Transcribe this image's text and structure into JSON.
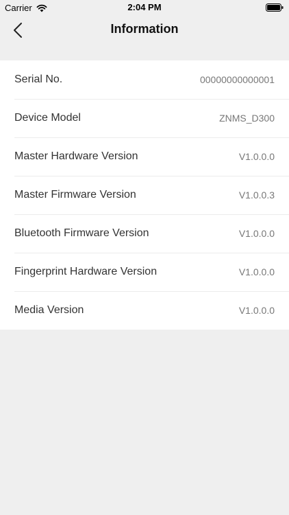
{
  "status_bar": {
    "carrier": "Carrier",
    "time": "2:04 PM",
    "icons": [
      "wifi-icon",
      "battery-icon"
    ]
  },
  "nav": {
    "title": "Information",
    "back_icon": "chevron-left-icon"
  },
  "info": {
    "rows": [
      {
        "label": "Serial No.",
        "value": "00000000000001"
      },
      {
        "label": "Device Model",
        "value": "ZNMS_D300"
      },
      {
        "label": "Master Hardware Version",
        "value": "V1.0.0.0"
      },
      {
        "label": "Master Firmware Version",
        "value": "V1.0.0.3"
      },
      {
        "label": "Bluetooth Firmware Version",
        "value": "V1.0.0.0"
      },
      {
        "label": "Fingerprint Hardware Version",
        "value": "V1.0.0.0"
      },
      {
        "label": "Media Version",
        "value": "V1.0.0.0"
      }
    ]
  },
  "colors": {
    "background": "#efefef",
    "card": "#ffffff",
    "label_text": "#333333",
    "value_text": "#777777"
  }
}
